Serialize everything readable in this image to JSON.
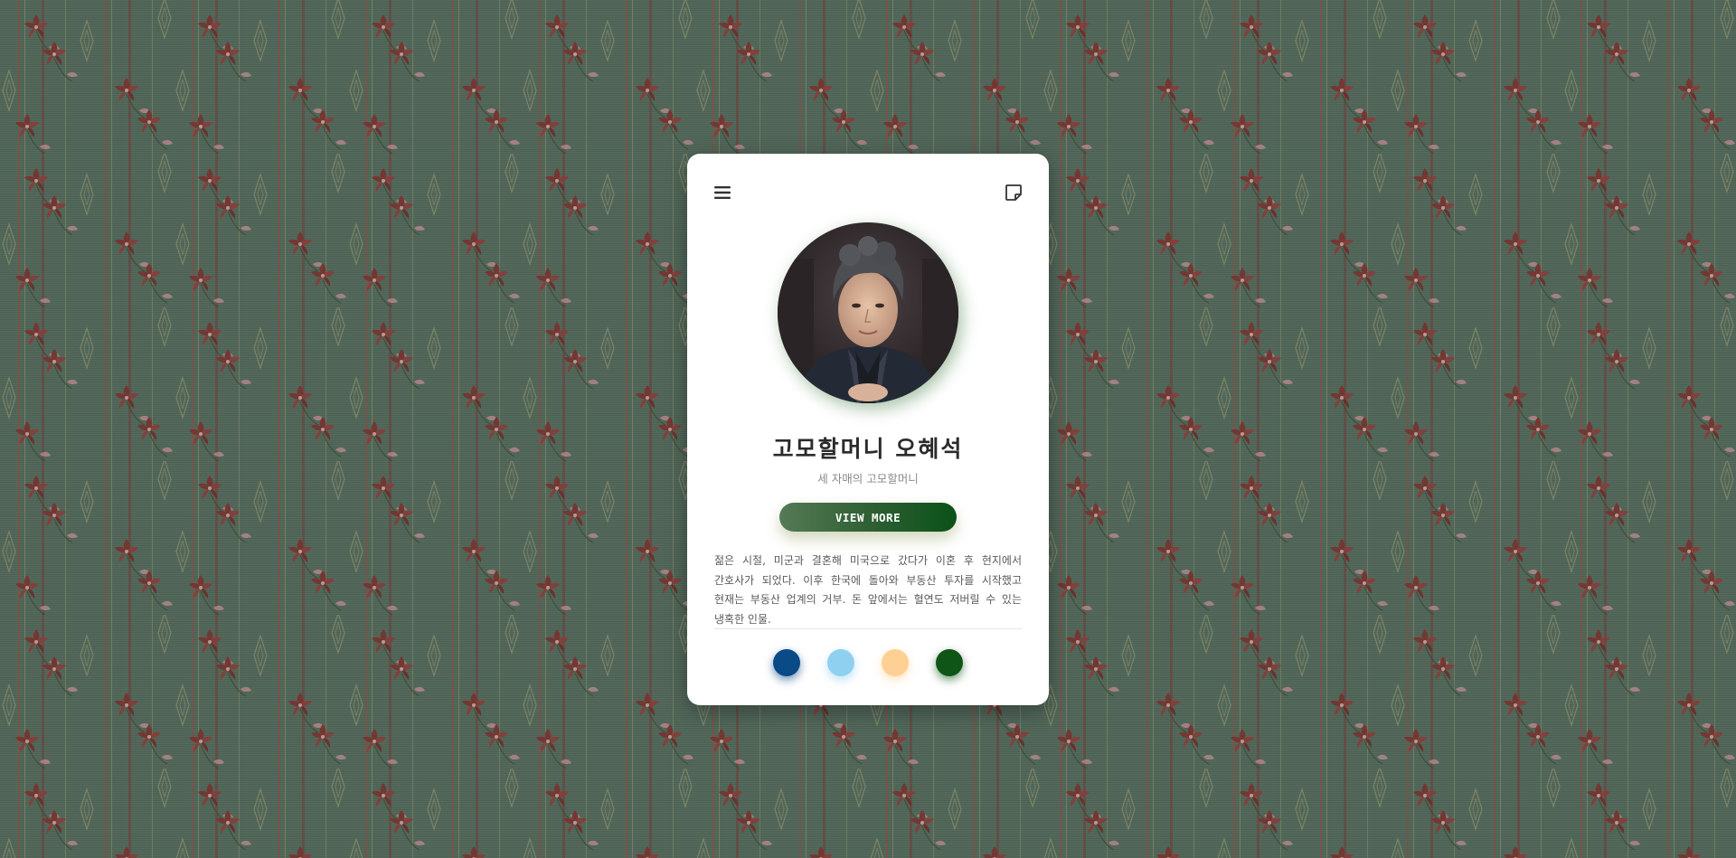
{
  "card": {
    "name": "고모할머니 오혜석",
    "subtitle": "세 자매의 고모할머니",
    "button_label": "VIEW MORE",
    "description": "젊은 시절, 미군과 결혼해 미국으로 갔다가 이혼 후 현지에서 간호사가 되었다. 이후 한국에 돌아와 부동산 투자를 시작했고 현재는 부동산 업계의 거부. 돈 앞에서는 혈연도 저버릴 수 있는 냉혹한 인물.",
    "menu_icon": "hamburger-menu-icon",
    "note_icon": "sticky-note-icon"
  },
  "swatches": [
    {
      "name": "navy",
      "color": "#0a4a86"
    },
    {
      "name": "sky-blue",
      "color": "#8fd0f0"
    },
    {
      "name": "peach",
      "color": "#ffd093"
    },
    {
      "name": "dark-green",
      "color": "#0f5518"
    }
  ],
  "colors": {
    "button_gradient_start": "#557a55",
    "button_gradient_end": "#0b5218",
    "card_background": "#ffffff"
  }
}
